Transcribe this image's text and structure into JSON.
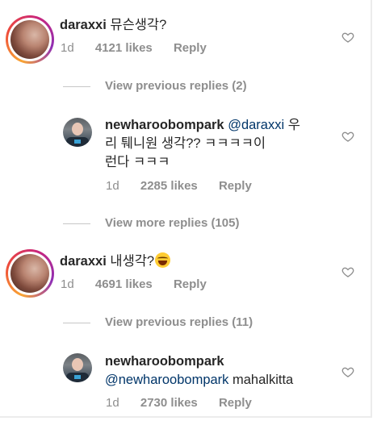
{
  "comments": [
    {
      "username": "daraxxi",
      "text": "뮤슨생각?",
      "age": "1d",
      "likes": "4121 likes",
      "reply_label": "Reply"
    },
    {
      "username": "newharoobompark",
      "mention": "@daraxxi",
      "text_line1": " 우",
      "text_line2": "리 퉤니원 생각?? ㅋㅋㅋㅋ이",
      "text_line3": "런다 ㅋㅋㅋ",
      "age": "1d",
      "likes": "2285 likes",
      "reply_label": "Reply"
    },
    {
      "username": "daraxxi",
      "text": "내생각?",
      "age": "1d",
      "likes": "4691 likes",
      "reply_label": "Reply"
    },
    {
      "username": "newharoobompark",
      "mention": "@newharoobompark",
      "text": " mahalkitta",
      "age": "1d",
      "likes": "2730 likes",
      "reply_label": "Reply"
    }
  ],
  "threads": [
    {
      "label": "View previous replies (2)"
    },
    {
      "label": "View more replies (105)"
    },
    {
      "label": "View previous replies (11)"
    }
  ],
  "icons": {
    "heart": "heart-outline-icon",
    "emoji": "grinning-squinting-face-emoji"
  },
  "colors": {
    "text": "#262626",
    "meta": "#8e8e8e",
    "mention": "#003569",
    "story_ring": [
      "#f9a534",
      "#ee4b3a",
      "#c9267c",
      "#8f2fb5"
    ]
  }
}
